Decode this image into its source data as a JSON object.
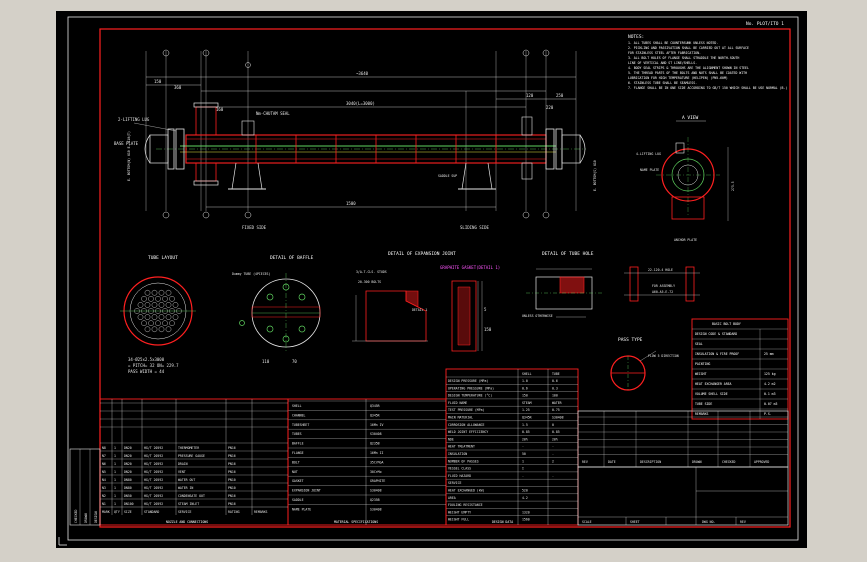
{
  "drawing": {
    "sheet_mark": "No. PLOT/ITO 1",
    "notes": {
      "title": "NOTES:",
      "items": [
        "1. ALL TUBES SHALL BE COUNTERSUNK UNLESS NOTED.",
        "2. PICKLING AND PASSIVATION SHALL BE CARRIED OUT AT ALL SURFACE",
        "   FOR STAINLESS STEEL AFTER FABRICATION.",
        "3. ALL BOLT HOLES OF FLANGE SHALL STRADDLE THE NORTH-SOUTH",
        "   LINE OF VERTICAL AND ST LINE/SHELLS.",
        "4. BODY SEAL STRIPS & THROUGHS ARE THE ALIGNMENT SHOWN IN STEEL",
        "5. THE THREAD PARTS OF THE BOLTS AND NUTS SHALL BE COATED WITH",
        "   LUBRICATION FOR HIGH TEMPERATURE (HELIPEN) (PN5-60M)",
        "6. STAINLESS TUBE SHALL BE SEAMLESS.",
        "7. FLANGE SHALL BE IN ONE SIDE ACCORDING TO GB/T 150 WHICH SHALL BE USE NORMAL (B-)"
      ]
    },
    "main_view": {
      "overall_dim": "~3640",
      "inner_dim": "3040(L=3000)",
      "dims_top": [
        "150",
        "360",
        "160",
        "120",
        "250",
        "220"
      ],
      "shell_label": "Nm-CHUTAM SEAL",
      "fixed_side": "FIXED SIDE",
      "sliding_side": "SLIDING SIDE",
      "lifting_lug": "2-LIFTING LUG",
      "base_plate": "BASE PLATE",
      "nameplate": "NAME PLATE",
      "support_label": "SADDLE SUP",
      "nozzle_tags": [
        "N1",
        "N2",
        "N3",
        "N4",
        "N5",
        "N6",
        "N7",
        "N8"
      ],
      "dim_bottom": "1500",
      "dim_side_left": "E. BOTTOM(N) 810 E. 810(T)",
      "dim_side_right": "E. BOTTOM(S) 810"
    },
    "a_view": {
      "title": "A VIEW",
      "lifting_lug": "4-LIFTING LUG",
      "name_plate": "NAME PLATE",
      "anchor_plate": "ANCHOR PLATE",
      "dim": "275.5"
    },
    "tube_layout": {
      "title": "TUBE LAYOUT",
      "spec": "34-Ø25x2.5x3000",
      "pitch": "= PITCH= 32  ON= 229.7",
      "passes": "PASS WIDTH = 44"
    },
    "baffle": {
      "title": "DETAIL OF BAFFLE",
      "label": "Dummy TUBE (4PIECES)",
      "dims": [
        "110",
        "70"
      ]
    },
    "expansion": {
      "title": "DETAIL OF EXPANSION JOINT",
      "tag": "DETAIL 1",
      "callout": "GRAPHITE GASKET(DETAIL 1)",
      "dims": [
        "3/A-T-CLS. STUDS",
        "20-300 BOLTS",
        "5",
        "150"
      ]
    },
    "nozzle_detail": {
      "title": "DETAIL OF TUBE HOLE",
      "note": "UNLESS OTHERWISE"
    },
    "flange_detail": {
      "labels": [
        "22-120-4 HOLE",
        "FOR ASSEMBLY",
        "A60-A5-E-72"
      ]
    },
    "pass_detail": {
      "title": "PASS TYPE",
      "note": "FLOW 5 DIRECTION"
    },
    "bom": {
      "title": "BASIC BOLT BODY",
      "rows": [
        [
          "DESIGN CODE & STANDARD",
          "",
          ""
        ],
        [
          "SEAL",
          "",
          ""
        ],
        [
          "INSULATION & FIRE PROOF",
          "",
          "25 mm"
        ],
        [
          "PAINTING",
          "",
          ""
        ],
        [
          "WEIGHT",
          "",
          "125 kg"
        ],
        [
          "HEAT EXCHANGER AREA",
          "",
          "4.2 m2"
        ],
        [
          "VOLUME  SHELL SIDE",
          "",
          "0.1 m3"
        ],
        [
          "         TUBE SIDE",
          "",
          "0.07 m3"
        ],
        [
          "REMARKS",
          "",
          "P.S."
        ]
      ]
    },
    "design_data": {
      "title": "DESIGN DATA",
      "col_heads": [
        "",
        "SHELL",
        "TUBE"
      ],
      "rows": [
        [
          "DESIGN PRESSURE (MPa)",
          "1.0",
          "0.6"
        ],
        [
          "OPERATING PRESSURE (MPa)",
          "0.6",
          "0.3"
        ],
        [
          "DESIGN TEMPERATURE (°C)",
          "150",
          "100"
        ],
        [
          "FLUID NAME",
          "STEAM",
          "WATER"
        ],
        [
          "TEST PRESSURE (MPa)",
          "1.25",
          "0.75"
        ],
        [
          "MAIN MATERIAL",
          "Q345R",
          "S30408"
        ],
        [
          "CORROSION ALLOWANCE",
          "1.5",
          "0"
        ],
        [
          "WELD JOINT EFFICIENCY",
          "0.85",
          "0.85"
        ],
        [
          "NDE",
          "20%",
          "20%"
        ],
        [
          "HEAT TREATMENT",
          "-",
          "-"
        ],
        [
          "INSULATION",
          "50",
          "-"
        ],
        [
          "NUMBER OF PASSES",
          "1",
          "2"
        ],
        [
          "VESSEL CLASS",
          "I",
          ""
        ],
        [
          "FLUID HAZARD",
          "-",
          "-"
        ],
        [
          "SERVICE",
          "",
          ""
        ],
        [
          "HEAT EXCHANGED (kW)",
          "520",
          ""
        ],
        [
          "AREA",
          "4.2",
          ""
        ],
        [
          "FOULING RESISTANCE",
          "",
          ""
        ],
        [
          "WEIGHT EMPTY",
          "1320",
          ""
        ],
        [
          "WEIGHT FULL",
          "1560",
          ""
        ]
      ]
    },
    "material_spec": {
      "title": "MATERIAL SPECIFICATIONS",
      "rows": [
        [
          "SHELL",
          "Q345R"
        ],
        [
          "CHANNEL",
          "Q345R"
        ],
        [
          "TUBESHEET",
          "16Mn IV"
        ],
        [
          "TUBES",
          "S30408"
        ],
        [
          "BAFFLE",
          "Q235B"
        ],
        [
          "FLANGE",
          "16Mn II"
        ],
        [
          "BOLT",
          "35CrMoA"
        ],
        [
          "NUT",
          "30CrMo"
        ],
        [
          "GASKET",
          "GRAPHITE"
        ],
        [
          "EXPANSION JOINT",
          "S30408"
        ],
        [
          "SADDLE",
          "Q235B"
        ],
        [
          "NAME PLATE",
          "S30408"
        ]
      ]
    },
    "nozzles": {
      "title": "NOZZLE AND CONNECTIONS",
      "col_heads": [
        "MARK",
        "QTY",
        "SIZE",
        "STANDARD",
        "SERVICE",
        "RATING",
        "REMARKS"
      ],
      "rows": [
        [
          "N1",
          "1",
          "DN100",
          "HG/T 20592",
          "STEAM INLET",
          "PN16",
          ""
        ],
        [
          "N2",
          "1",
          "DN50",
          "HG/T 20592",
          "CONDENSATE OUT",
          "PN16",
          ""
        ],
        [
          "N3",
          "1",
          "DN80",
          "HG/T 20592",
          "WATER IN",
          "PN10",
          ""
        ],
        [
          "N4",
          "1",
          "DN80",
          "HG/T 20592",
          "WATER OUT",
          "PN10",
          ""
        ],
        [
          "N5",
          "1",
          "DN20",
          "HG/T 20592",
          "VENT",
          "PN16",
          ""
        ],
        [
          "N6",
          "1",
          "DN20",
          "HG/T 20592",
          "DRAIN",
          "PN16",
          ""
        ],
        [
          "N7",
          "1",
          "DN20",
          "HG/T 20592",
          "PRESSURE GAUGE",
          "PN16",
          ""
        ],
        [
          "N8",
          "1",
          "DN20",
          "HG/T 20592",
          "THERMOMETER",
          "PN16",
          ""
        ]
      ]
    },
    "revision": {
      "labels": [
        "REV",
        "DATE",
        "DESCRIPTION",
        "DRAWN",
        "CHECKED",
        "APPROVED"
      ]
    },
    "title_block": {
      "company": "",
      "scale_label": "SCALE",
      "sheet_label": "SHEET",
      "dwg_label": "DWG NO.",
      "rev_label": "REV"
    },
    "side_strip": [
      "CHECKED",
      "DRAWN",
      "DESIGN"
    ]
  },
  "colors": {
    "background": "#000000",
    "frame": "#ff2020",
    "lines": "#e6e6e6",
    "centerline": "#6fe06f",
    "dimension": "#e6e6e6",
    "hatch": "#ff3030",
    "highlight": "#ff55ff",
    "shell": "#ff2020",
    "tube": "#5fd35f"
  }
}
